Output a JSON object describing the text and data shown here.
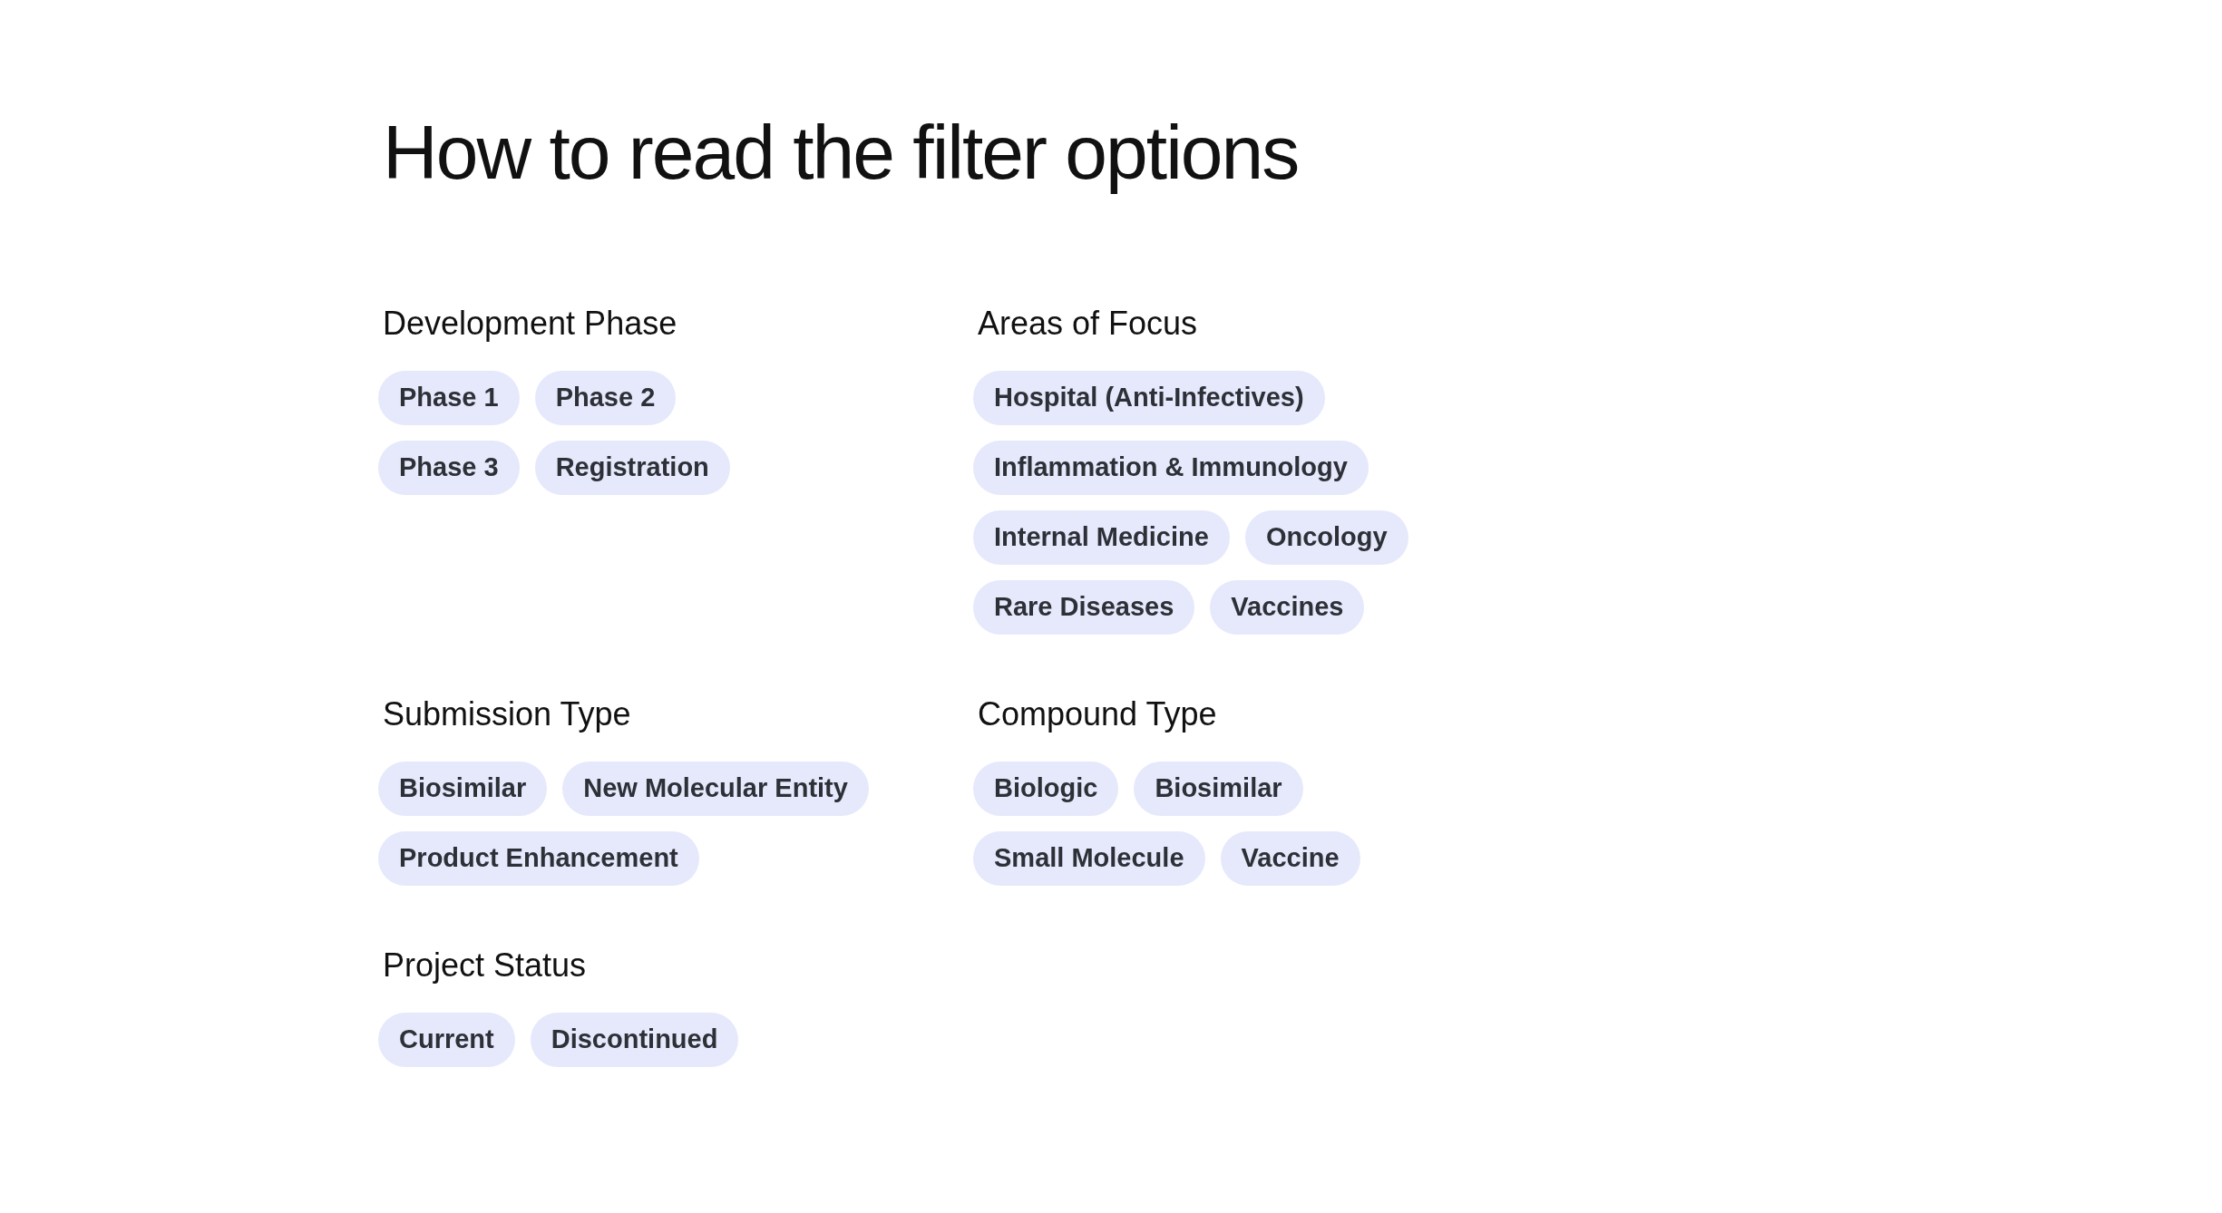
{
  "title": "How to read the filter options",
  "sections": [
    {
      "heading": "Development Phase",
      "rows": [
        [
          "Phase 1",
          "Phase 2"
        ],
        [
          "Phase 3",
          "Registration"
        ]
      ]
    },
    {
      "heading": "Areas of Focus",
      "rows": [
        [
          "Hospital (Anti-Infectives)"
        ],
        [
          "Inflammation & Immunology"
        ],
        [
          "Internal Medicine",
          "Oncology"
        ],
        [
          "Rare Diseases",
          "Vaccines"
        ]
      ]
    },
    {
      "heading": "Submission Type",
      "rows": [
        [
          "Biosimilar",
          "New Molecular Entity"
        ],
        [
          "Product Enhancement"
        ]
      ]
    },
    {
      "heading": "Compound Type",
      "rows": [
        [
          "Biologic",
          "Biosimilar"
        ],
        [
          "Small Molecule",
          "Vaccine"
        ]
      ]
    },
    {
      "heading": "Project Status",
      "rows": [
        [
          "Current",
          "Discontinued"
        ]
      ]
    }
  ]
}
